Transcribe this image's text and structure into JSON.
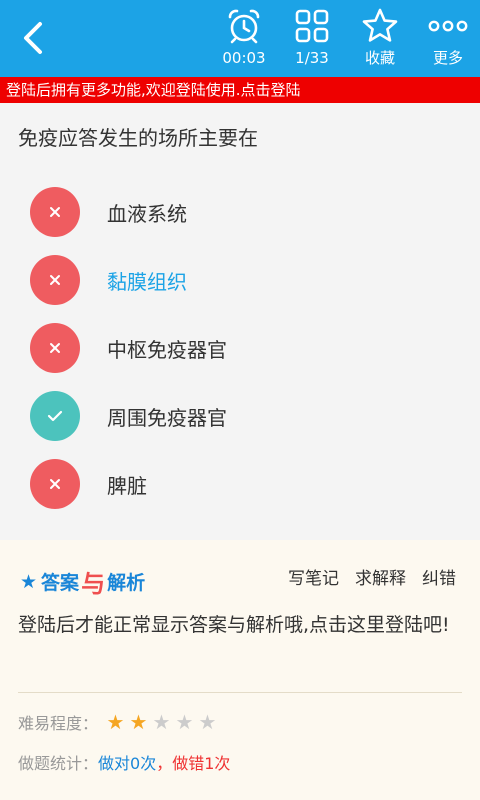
{
  "toolbar": {
    "timer_label": "00:03",
    "progress_label": "1/33",
    "favorite_label": "收藏",
    "more_label": "更多"
  },
  "banner": {
    "text": "登陆后拥有更多功能,欢迎登陆使用.点击登陆"
  },
  "question": {
    "text": "免疫应答发生的场所主要在",
    "options": [
      {
        "label": "血液系统",
        "state": "wrong"
      },
      {
        "label": "黏膜组织",
        "state": "wrong-selected"
      },
      {
        "label": "中枢免疫器官",
        "state": "wrong"
      },
      {
        "label": "周围免疫器官",
        "state": "correct"
      },
      {
        "label": "脾脏",
        "state": "wrong"
      }
    ]
  },
  "answer": {
    "title_part1": "答案",
    "title_part2": "与",
    "title_part3": "解析",
    "actions": [
      "写笔记",
      "求解释",
      "纠错"
    ],
    "note": "登陆后才能正常显示答案与解析哦,点击这里登陆吧!",
    "difficulty_label": "难易程度：",
    "difficulty_rating": 2,
    "difficulty_max": 5,
    "stats_label": "做题统计：",
    "stats_correct": "做对0次",
    "stats_sep": "，",
    "stats_wrong": "做错1次"
  },
  "colors": {
    "toolbar_bg": "#1ca3e6",
    "banner_bg": "#ee0000",
    "wrong_circle": "#ef5c60",
    "correct_circle": "#4cc3bd",
    "selected_text": "#1ca3e6",
    "star_filled": "#f5a623",
    "star_empty": "#cccccc"
  }
}
